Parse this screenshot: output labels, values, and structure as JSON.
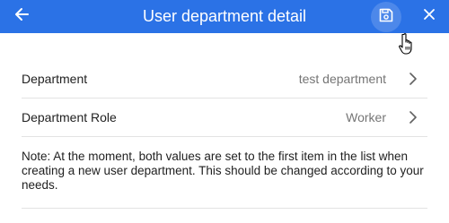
{
  "header": {
    "title": "User department detail",
    "background_color": "#2b72e6",
    "back_icon": "arrow-left-icon",
    "save_icon": "floppy-disk-icon",
    "close_icon": "close-icon"
  },
  "fields": [
    {
      "label": "Department",
      "value": "test department",
      "icon": "chevron-right-icon"
    },
    {
      "label": "Department Role",
      "value": "Worker",
      "icon": "chevron-right-icon"
    }
  ],
  "note": "Note: At the moment, both values are set to the first item in the list when creating a new user department. This should be changed according to your needs."
}
